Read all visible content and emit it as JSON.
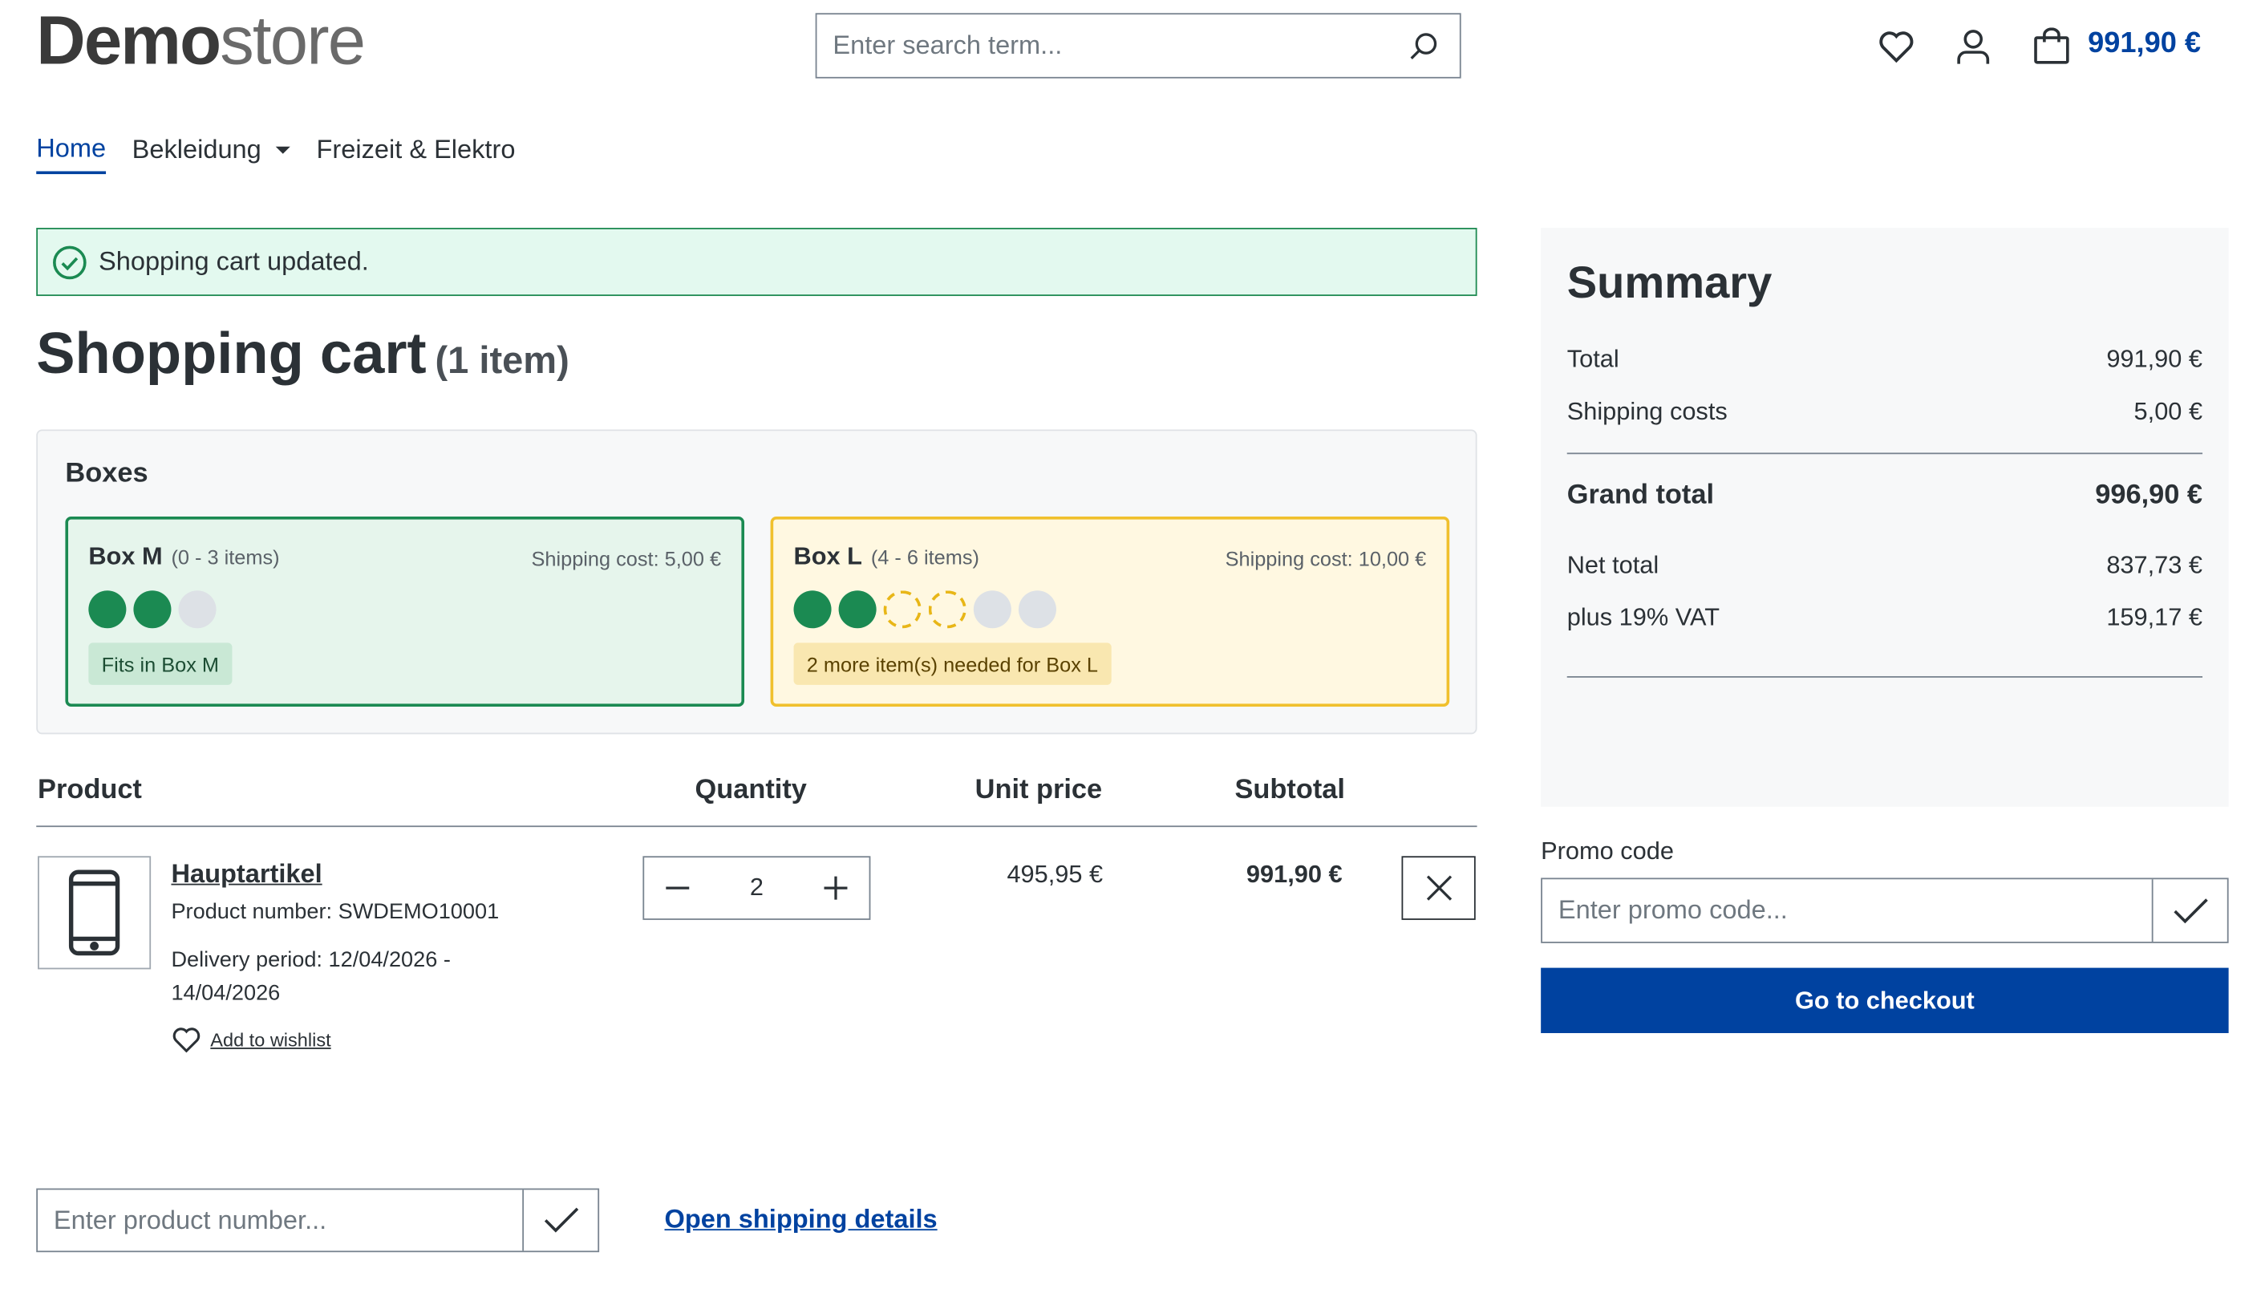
{
  "header": {
    "logo_bold": "Demo",
    "logo_light": "store",
    "search_placeholder": "Enter search term...",
    "cart_total": "991,90 €",
    "icons": [
      "heart-icon",
      "user-icon",
      "bag-icon",
      "search-icon"
    ]
  },
  "nav": {
    "items": [
      {
        "label": "Home",
        "active": true
      },
      {
        "label": "Bekleidung",
        "dropdown": true
      },
      {
        "label": "Freizeit & Elektro"
      }
    ]
  },
  "alert": {
    "message": "Shopping cart updated."
  },
  "page": {
    "title": "Shopping cart",
    "count": "(1 item)"
  },
  "boxes": {
    "label": "Boxes",
    "items": [
      {
        "name": "Box M",
        "range": "(0 - 3 items)",
        "shipping": "Shipping cost: 5,00 €",
        "filled": 2,
        "needed": 0,
        "empty": 1,
        "badge": "Fits in Box M",
        "color": "#1b8a52"
      },
      {
        "name": "Box L",
        "range": "(4 - 6 items)",
        "shipping": "Shipping cost: 10,00 €",
        "filled": 2,
        "needed": 2,
        "empty": 2,
        "badge": "2 more item(s) needed for Box L",
        "color": "#f0c02d"
      }
    ]
  },
  "table": {
    "headers": {
      "product": "Product",
      "quantity": "Quantity",
      "unit_price": "Unit price",
      "subtotal": "Subtotal"
    },
    "rows": [
      {
        "name": "Hauptartikel",
        "product_number": "Product number: SWDEMO10001",
        "delivery": "Delivery period: 12/04/2026 - 14/04/2026",
        "wishlist": "Add to wishlist",
        "quantity": "2",
        "unit_price": "495,95 €",
        "subtotal": "991,90 €"
      }
    ]
  },
  "summary": {
    "title": "Summary",
    "total_label": "Total",
    "total_value": "991,90 €",
    "shipping_label": "Shipping costs",
    "shipping_value": "5,00 €",
    "grand_label": "Grand total",
    "grand_value": "996,90 €",
    "net_label": "Net total",
    "net_value": "837,73 €",
    "vat_label": "plus 19% VAT",
    "vat_value": "159,17 €"
  },
  "promo": {
    "label": "Promo code",
    "placeholder": "Enter promo code..."
  },
  "checkout": {
    "label": "Go to checkout"
  },
  "footer": {
    "product_number_placeholder": "Enter product number...",
    "shipping_link": "Open shipping details"
  },
  "colors": {
    "primary": "#0042a0",
    "success": "#1b8a52",
    "warning": "#f0c02d"
  }
}
